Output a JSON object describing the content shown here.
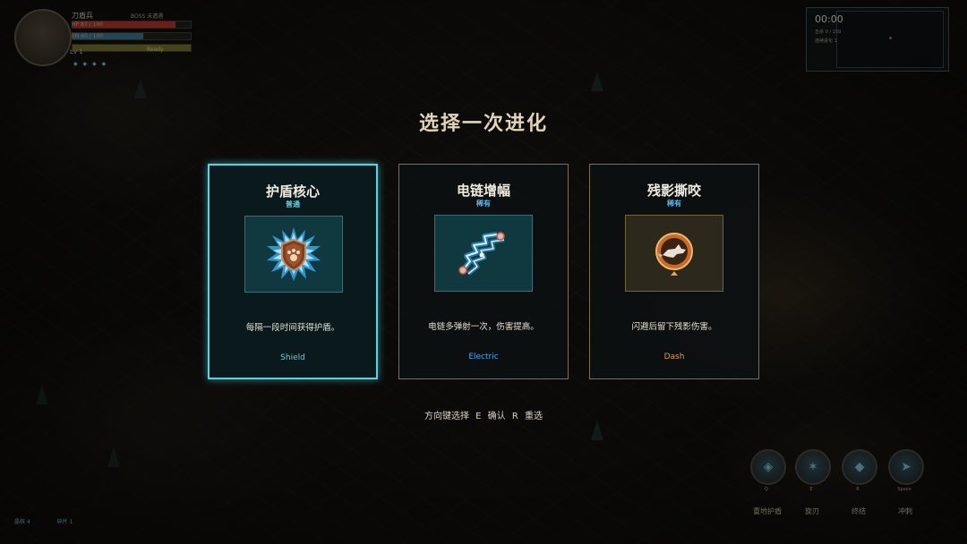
{
  "hud": {
    "player_name": "刀盾兵",
    "player_state": "BOSS 未遭遇",
    "hp_text": "HP 87 / 100",
    "energy_text": "EN 60 / 100",
    "skill_text": "Lv 1",
    "ready_text": "Ready",
    "timer": "00:00",
    "stat_line_1": "击杀 0 / 159",
    "stat_line_2": "连续进化 1",
    "bottom_left": [
      "晶核 4",
      "碎片 1"
    ],
    "skills": [
      {
        "name": "重地护盾",
        "key": "Q",
        "icon": "shield-skill-icon",
        "glyph": "◈"
      },
      {
        "name": "旋刃",
        "key": "E",
        "icon": "blade-skill-icon",
        "glyph": "✶"
      },
      {
        "name": "终结",
        "key": "R",
        "icon": "finisher-skill-icon",
        "glyph": "◆"
      },
      {
        "name": "冲刺",
        "key": "Space",
        "icon": "dash-skill-icon",
        "glyph": "➤"
      }
    ]
  },
  "overlay": {
    "title": "选择一次进化",
    "hint": "方向键选择  E 确认  R 重选",
    "selected_index": 0,
    "cards": [
      {
        "name": "护盾核心",
        "rarity": "普通",
        "rarity_color": "#5fd4e8",
        "icon": "shield-core-icon",
        "description": "每隔一段时间获得护盾。",
        "tag": "Shield",
        "tag_color": "#5fd4e8"
      },
      {
        "name": "电链增幅",
        "rarity": "稀有",
        "rarity_color": "#5fb8f0",
        "icon": "chain-lightning-icon",
        "description": "电链多弹射一次，伤害提高。",
        "tag": "Electric",
        "tag_color": "#4fa8e8"
      },
      {
        "name": "残影撕咬",
        "rarity": "稀有",
        "rarity_color": "#5fb8f0",
        "icon": "afterimage-wolf-icon",
        "description": "闪避后留下残影伤害。",
        "tag": "Dash",
        "tag_color": "#e39b48"
      }
    ]
  }
}
